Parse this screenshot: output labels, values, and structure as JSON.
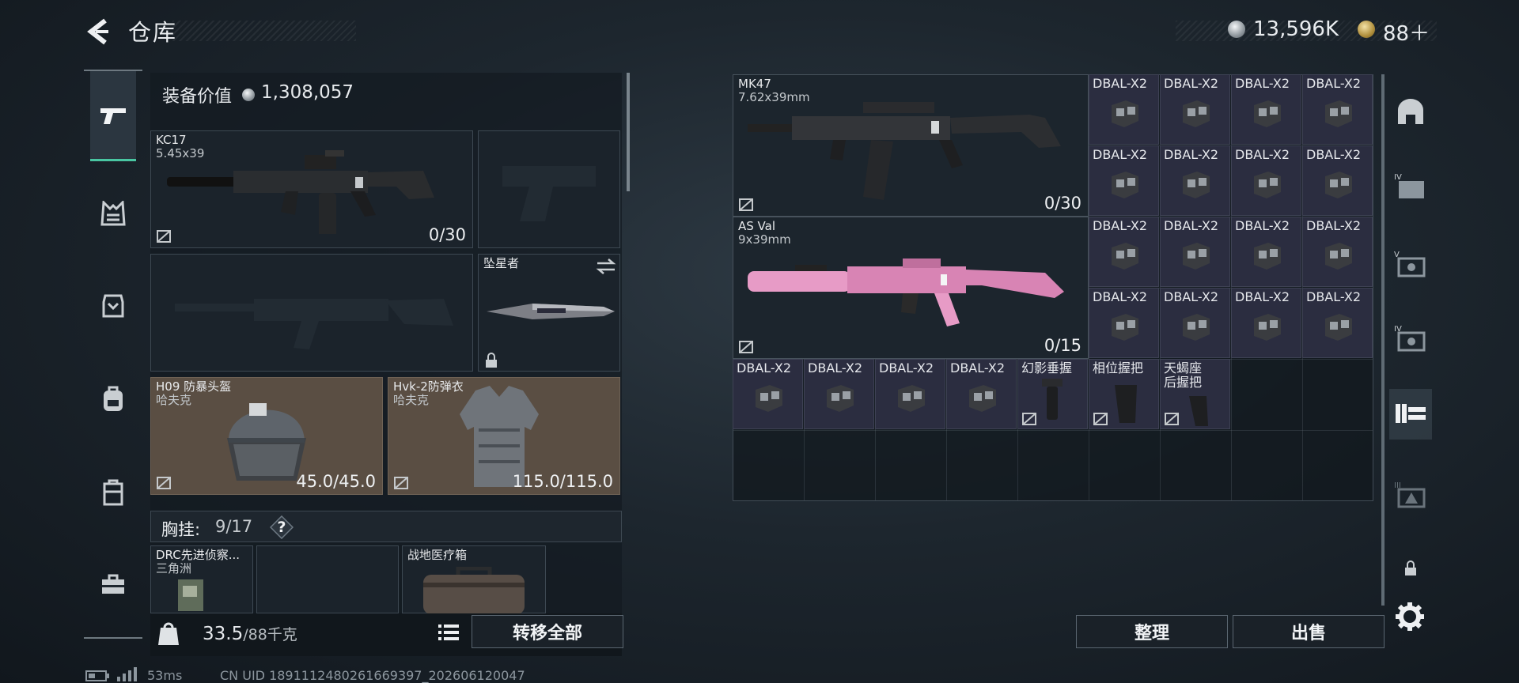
{
  "header": {
    "title": "仓库",
    "back_icon": "back-arrow-icon",
    "currency_silver": "13,596K",
    "currency_gold": "88＋"
  },
  "sidebar": {
    "items": [
      {
        "icon": "pistol-icon",
        "selected": true
      },
      {
        "icon": "chest-rig-icon"
      },
      {
        "icon": "armor-icon"
      },
      {
        "icon": "backpack-icon"
      },
      {
        "icon": "case-icon"
      },
      {
        "icon": "toolbox-icon"
      }
    ]
  },
  "equipment": {
    "value_label": "装备价值",
    "value": "1,308,057",
    "primary": {
      "name": "KC17",
      "caliber": "5.45x39",
      "ammo": "0/30"
    },
    "melee": {
      "name": "坠星者"
    },
    "helmet": {
      "name": "H09 防暴头盔",
      "maker": "哈夫克",
      "durability": "45.0/45.0"
    },
    "armor": {
      "name": "Hvk-2防弹衣",
      "maker": "哈夫克",
      "durability": "115.0/115.0"
    },
    "chest_rig": {
      "label": "胸挂:",
      "capacity": "9/17",
      "help": "?"
    },
    "rig_items": [
      {
        "name": "DRC先进侦察...",
        "sub": "三角洲"
      },
      {
        "name": "战地医疗箱"
      }
    ]
  },
  "bottom": {
    "weight": "33.5",
    "weight_max": "/88千克",
    "transfer_all": "转移全部",
    "sort": "整理",
    "sell": "出售"
  },
  "stash": {
    "guns": [
      {
        "name": "MK47",
        "caliber": "7.62x39mm",
        "ammo": "0/30"
      },
      {
        "name": "AS Val",
        "caliber": "9x39mm",
        "ammo": "0/15"
      }
    ],
    "scope_label": "DBAL-X2",
    "grips": [
      {
        "name": "幻影垂握"
      },
      {
        "name": "相位握把"
      },
      {
        "name": "天蝎座",
        "sub": "后握把"
      }
    ]
  },
  "right_nav": {
    "items": [
      "bunker-icon",
      "tier4-case-icon",
      "tier5-safe-icon",
      "tier4-safe-icon",
      "weapon-rack-icon",
      "tier3-display-icon",
      "lock-icon"
    ]
  },
  "status": {
    "ping": "53ms",
    "uid": "CN UID 1891112480261669397_202606120047"
  },
  "colors": {
    "accent": "#49c6a2",
    "armor_slot": "#5a4e43",
    "accessory_slot": "#2b2d40",
    "pink_skin": "#e79bc6"
  }
}
